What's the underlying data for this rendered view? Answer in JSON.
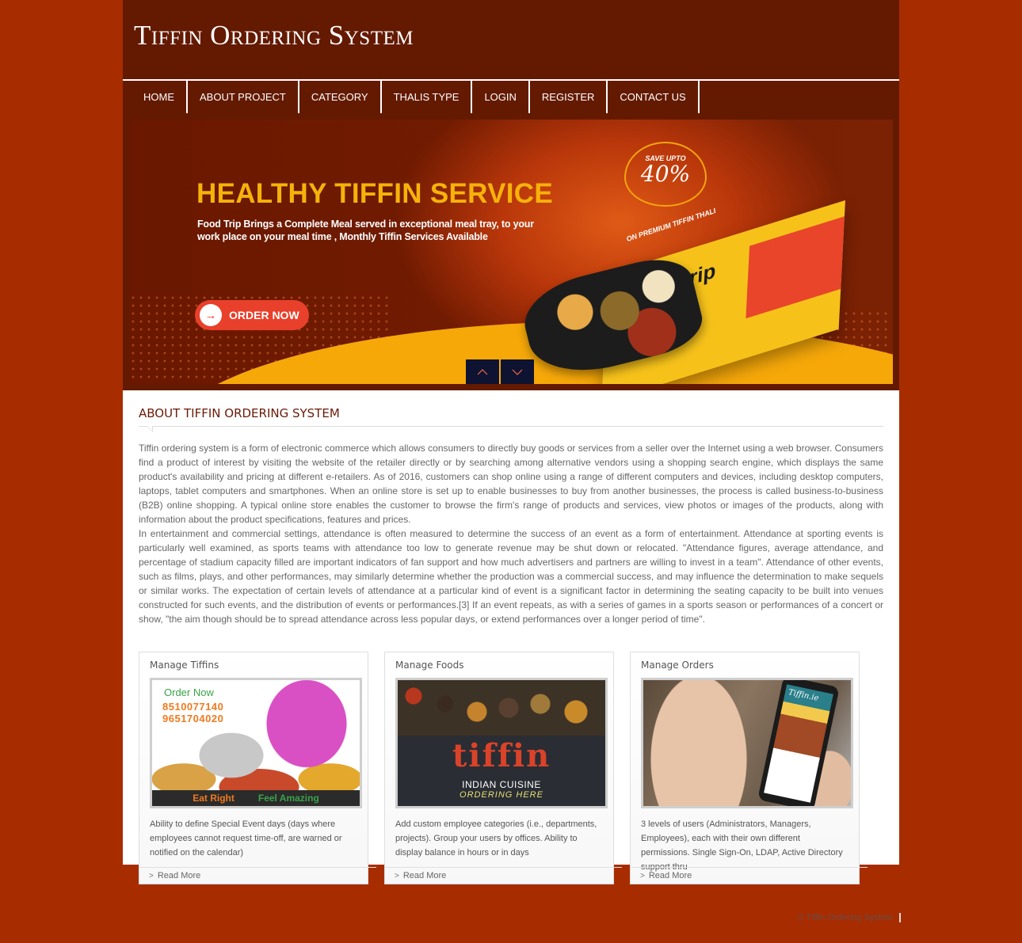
{
  "header": {
    "site_title": "Tiffin Ordering System"
  },
  "nav": {
    "items": [
      {
        "label": "HOME"
      },
      {
        "label": "ABOUT PROJECT"
      },
      {
        "label": "CATEGORY"
      },
      {
        "label": "THALIS TYPE"
      },
      {
        "label": "LOGIN"
      },
      {
        "label": "REGISTER"
      },
      {
        "label": "CONTACT US"
      }
    ]
  },
  "banner": {
    "headline": "HEALTHY TIFFIN SERVICE",
    "subtext": "Food Trip Brings a Complete Meal served in exceptional meal tray, to your work place on your meal time , Monthly Tiffin Services Available",
    "order_button": "ORDER NOW",
    "badge_small": "SAVE UPTO",
    "badge_big": "40%",
    "tray_tag": "ON PREMIUM TIFFIN THALI",
    "tray_brand": "foodtrip",
    "controls": {
      "prev": "up-chevron",
      "next": "down-chevron"
    },
    "colors": {
      "headline": "#f7b20a",
      "button": "#e8402b",
      "wave": "#f6a809",
      "controls": "#0e1331"
    }
  },
  "about": {
    "title": "ABOUT TIFFIN ORDERING SYSTEM",
    "paragraphs": [
      "Tiffin ordering system is a form of electronic commerce which allows consumers to directly buy goods or services from a seller over the Internet using a web browser. Consumers find a product of interest by visiting the website of the retailer directly or by searching among alternative vendors using a shopping search engine, which displays the same product's availability and pricing at different e-retailers. As of 2016, customers can shop online using a range of different computers and devices, including desktop computers, laptops, tablet computers and smartphones. When an online store is set up to enable businesses to buy from another businesses, the process is called business-to-business (B2B) online shopping. A typical online store enables the customer to browse the firm's range of products and services, view photos or images of the products, along with information about the product specifications, features and prices.",
      "In entertainment and commercial settings, attendance is often measured to determine the success of an event as a form of entertainment. Attendance at sporting events is particularly well examined, as sports teams with attendance too low to generate revenue may be shut down or relocated. \"Attendance figures, average attendance, and percentage of stadium capacity filled are important indicators of fan support and how much advertisers and partners are willing to invest in a team\". Attendance of other events, such as films, plays, and other performances, may similarly determine whether the production was a commercial success, and may influence the determination to make sequels or similar works. The expectation of certain levels of attendance at a particular kind of event is a significant factor in determining the seating capacity to be built into venues constructed for such events, and the distribution of events or performances.[3] If an event repeats, as with a series of games in a sports season or performances of a concert or show, \"the aim though should be to spread attendance across less popular days, or extend performances over a longer period of time\"."
    ]
  },
  "cards": [
    {
      "title": "Manage Tiffins",
      "image": {
        "order_text": "Order Now",
        "phone_1": "8510077140",
        "phone_2": "9651704020",
        "tagline_left": "Eat Right",
        "tagline_right": "Feel Amazing"
      },
      "description": "Ability to define Special Event days (days where employees cannot request time-off, are warned or notified on the calendar)",
      "link": "Read More"
    },
    {
      "title": "Manage Foods",
      "image": {
        "brand": "tiffin",
        "cuisine": "INDIAN CUISINE",
        "ordering": "ORDERING HERE"
      },
      "description": "Add custom employee categories (i.e., departments, projects). Group your users by offices. Ability to display balance in hours or in days",
      "link": "Read More"
    },
    {
      "title": "Manage Orders",
      "image": {
        "app_name": "Tiffin.ie"
      },
      "description": "3 levels of users (Administrators, Managers, Employees), each with their own different permissions. Single Sign-On, LDAP, Active Directory support thru",
      "link": "Read More"
    }
  ],
  "footer": {
    "copyright": "© Tiffin Ordering System"
  },
  "theme": {
    "page_bg": "#a72d00",
    "header_bg": "#631a00",
    "heading_color": "#6a1a06"
  }
}
